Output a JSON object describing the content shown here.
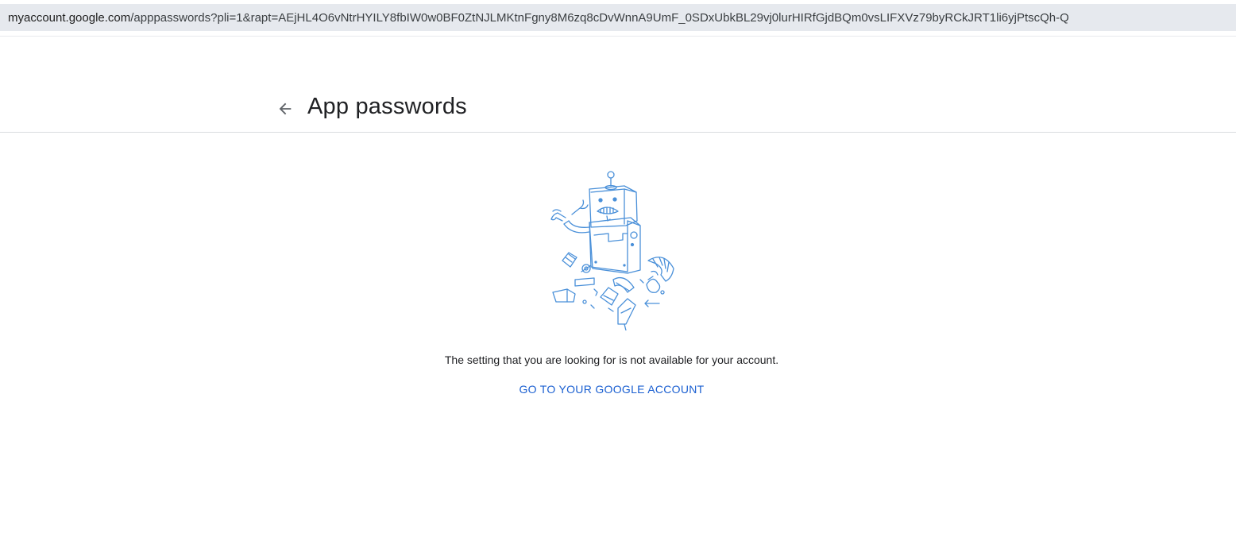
{
  "browser": {
    "url_host": "myaccount.google.com",
    "url_path": "/apppasswords?pli=1&rapt=AEjHL4O6vNtrHYILY8fbIW0w0BF0ZtNJLMKtnFgny8M6zq8cDvWnnA9UmF_0SDxUbkBL29vj0lurHIRfGjdBQm0vsLIFXVz79byRCkJRT1li6yjPtscQh-Q"
  },
  "header": {
    "back_icon": "arrow-left-icon",
    "title": "App passwords"
  },
  "main": {
    "illustration": "broken-robot-illustration",
    "message": "The setting that you are looking for is not available for your account.",
    "link_label": "GO TO YOUR GOOGLE ACCOUNT"
  },
  "colors": {
    "link": "#1a5fd1",
    "illustration_stroke": "#4a90d9",
    "url_bar_bg": "#e6e9ee"
  }
}
